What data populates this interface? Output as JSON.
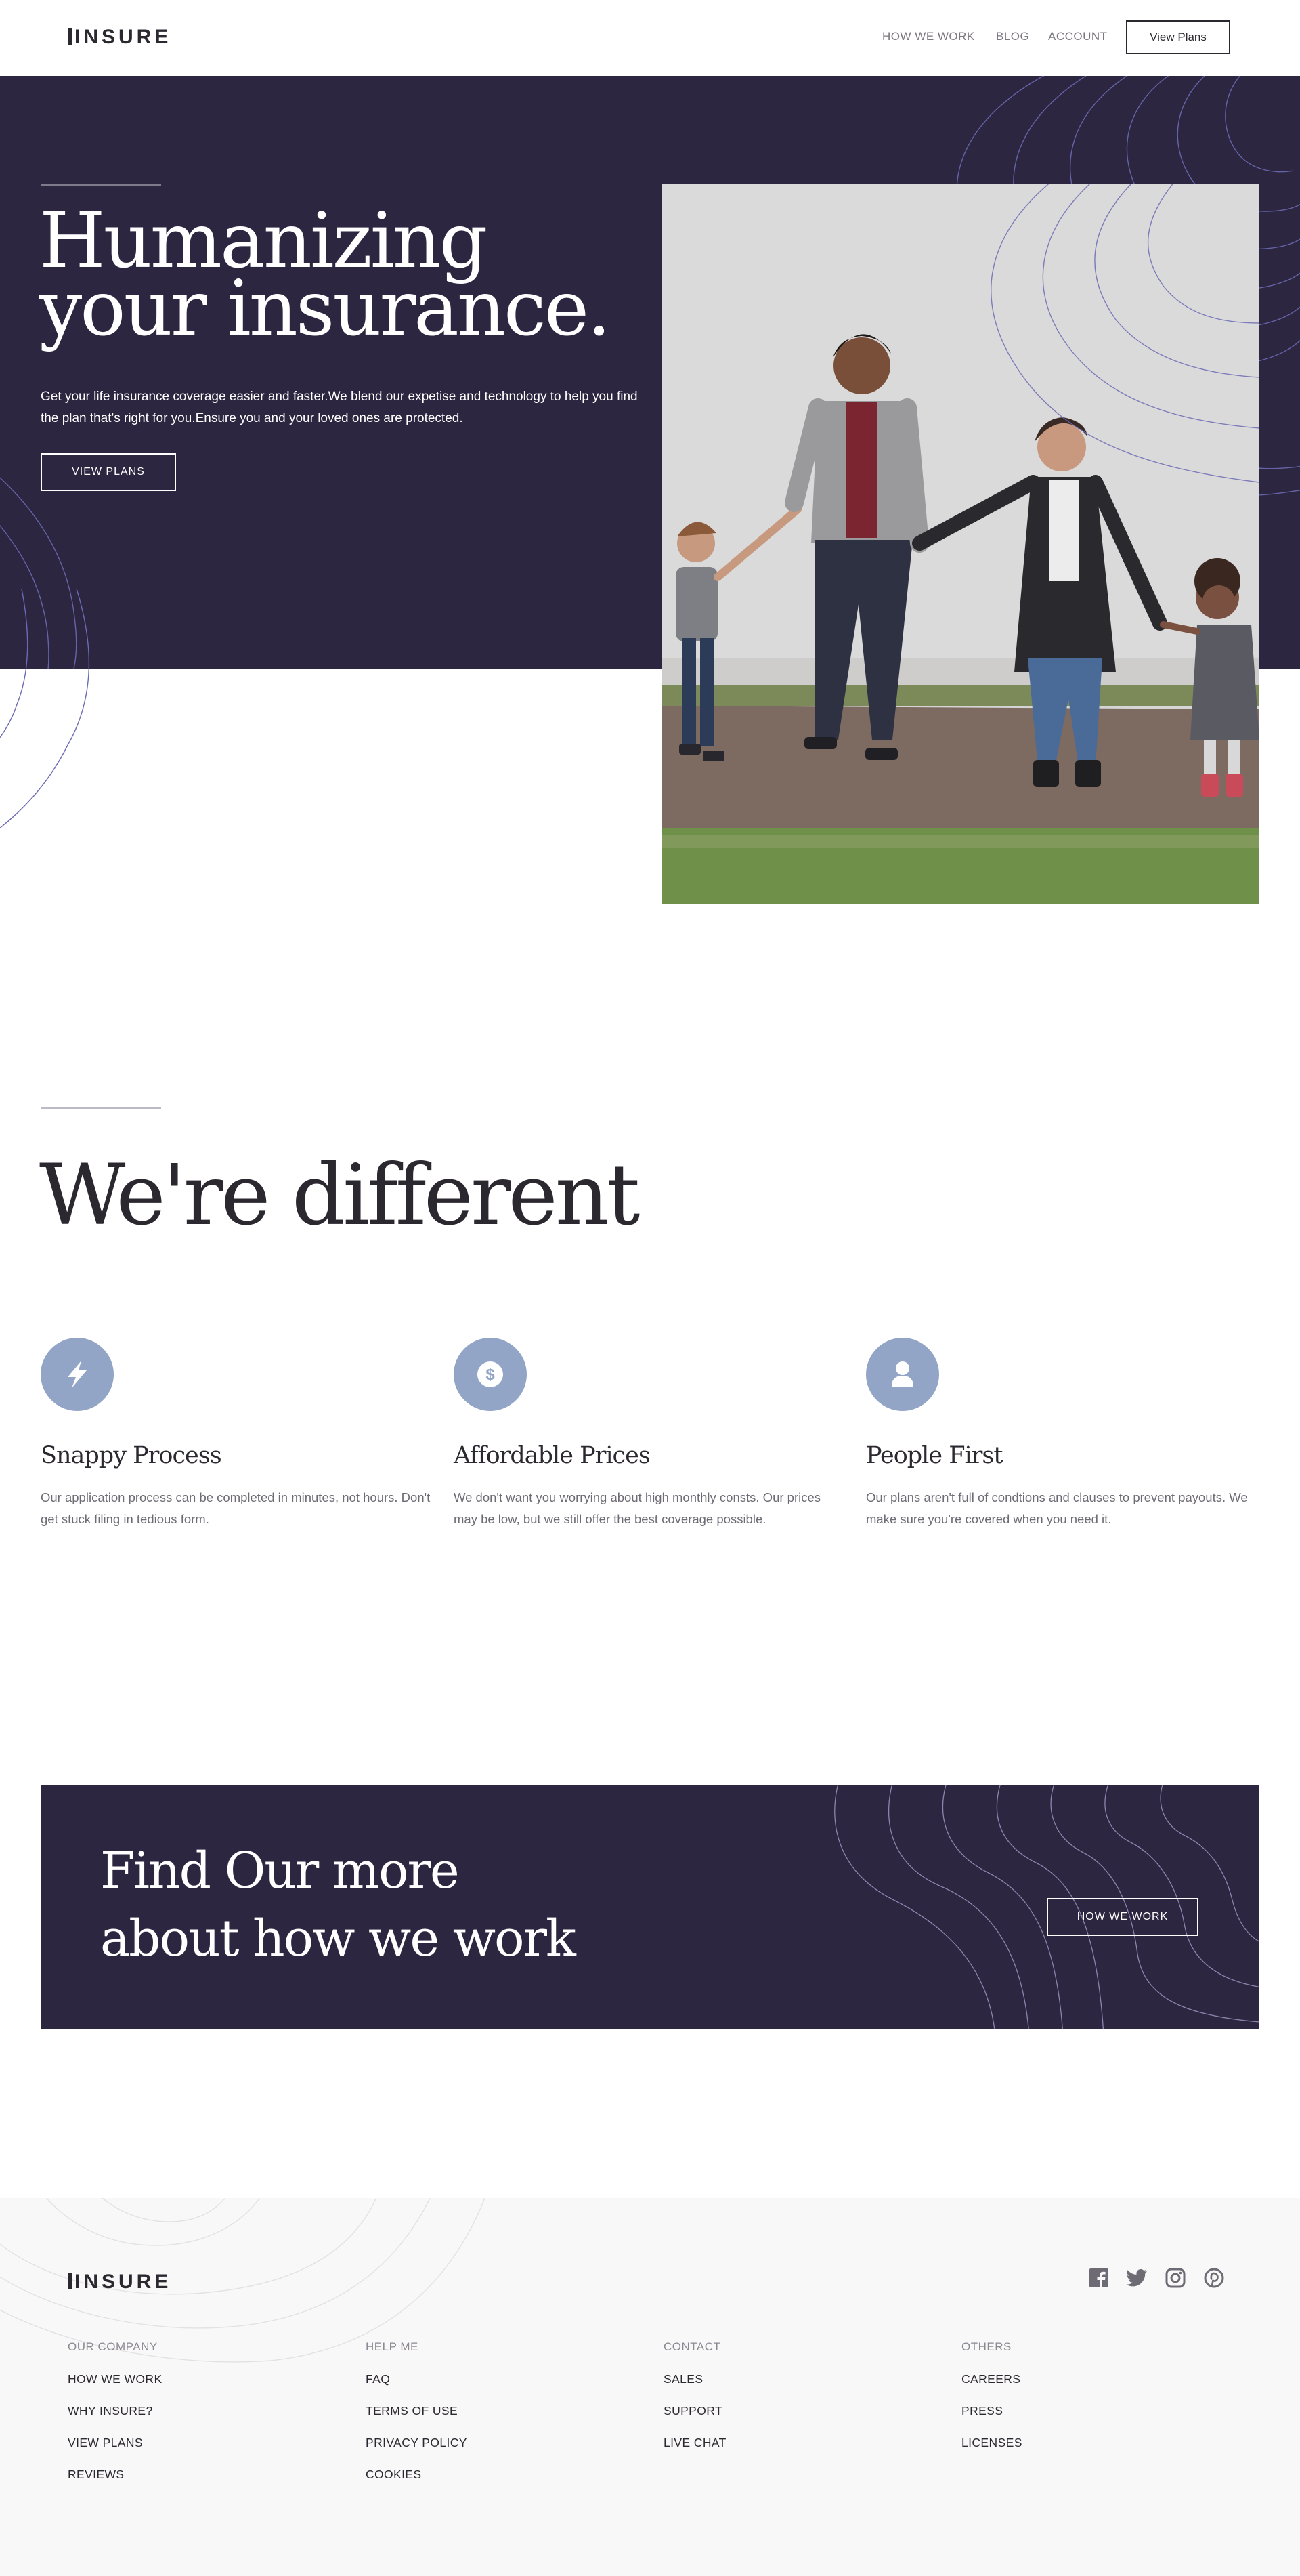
{
  "header": {
    "logo": "INSURE",
    "nav": [
      "HOW WE WORK",
      "BLOG",
      "ACCOUNT"
    ],
    "cta_label": "View Plans"
  },
  "hero": {
    "title_line1": "Humanizing",
    "title_line2": "your insurance.",
    "text": "Get your life insurance coverage easier and faster.We blend our expetise and technology to help you find the plan that's right for you.Ensure you and your loved ones are protected.",
    "button": "VIEW PLANS"
  },
  "different": {
    "title": "We're different",
    "features": [
      {
        "icon": "lightning-icon",
        "title": "Snappy Process",
        "text": "Our application process can be completed in minutes, not hours. Don't get stuck filing in tedious form."
      },
      {
        "icon": "dollar-icon",
        "title": "Affordable Prices",
        "text": "We don't want you worrying about high monthly consts. Our prices may be low, but we still offer the best coverage possible."
      },
      {
        "icon": "person-icon",
        "title": "People First",
        "text": "Our plans aren't full of condtions and clauses to prevent payouts. We make sure you're covered when you need it."
      }
    ]
  },
  "cta": {
    "title_line1": "Find Our more",
    "title_line2": "about how we work",
    "button": "HOW WE WORK"
  },
  "footer": {
    "logo": "INSURE",
    "social": [
      "facebook-icon",
      "twitter-icon",
      "instagram-icon",
      "pinterest-icon"
    ],
    "columns": [
      {
        "heading": "OUR COMPANY",
        "links": [
          "HOW WE WORK",
          "WHY INSURE?",
          "VIEW PLANS",
          "REVIEWS"
        ]
      },
      {
        "heading": "HELP ME",
        "links": [
          "FAQ",
          "TERMS OF USE",
          "PRIVACY POLICY",
          "COOKIES"
        ]
      },
      {
        "heading": "CONTACT",
        "links": [
          "SALES",
          "SUPPORT",
          "LIVE CHAT"
        ]
      },
      {
        "heading": "OTHERS",
        "links": [
          "CAREERS",
          "PRESS",
          "LICENSES"
        ]
      }
    ]
  },
  "colors": {
    "dark": "#2c2640",
    "accent": "#93a5c6",
    "text": "#2c2830",
    "muted": "#6e6b75"
  }
}
